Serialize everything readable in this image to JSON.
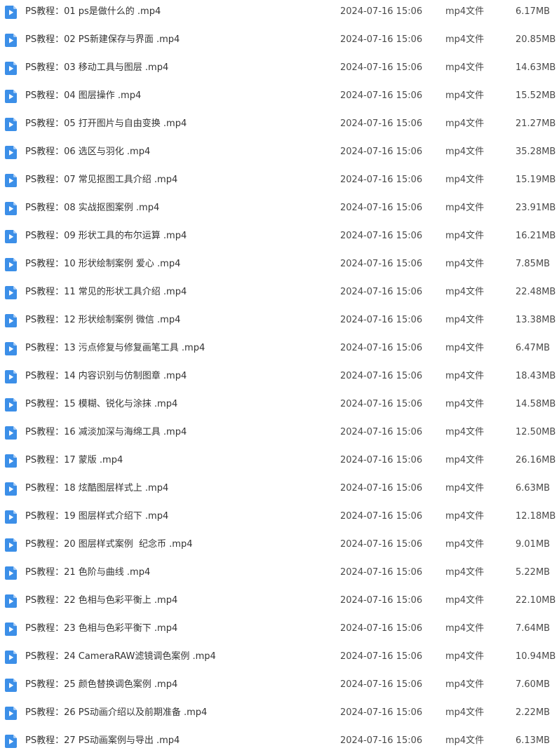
{
  "colors": {
    "icon_blue": "#3c8fe8",
    "icon_fold": "#a9cdf5",
    "text": "#333333"
  },
  "icon": "video-file-icon",
  "files": [
    {
      "name": "PS教程：01 ps是做什么的 .mp4",
      "date": "2024-07-16 15:06",
      "type": "mp4文件",
      "size": "6.17MB"
    },
    {
      "name": "PS教程：02 PS新建保存与界面 .mp4",
      "date": "2024-07-16 15:06",
      "type": "mp4文件",
      "size": "20.85MB"
    },
    {
      "name": "PS教程：03 移动工具与图层 .mp4",
      "date": "2024-07-16 15:06",
      "type": "mp4文件",
      "size": "14.63MB"
    },
    {
      "name": "PS教程：04 图层操作 .mp4",
      "date": "2024-07-16 15:06",
      "type": "mp4文件",
      "size": "15.52MB"
    },
    {
      "name": "PS教程：05 打开图片与自由变换 .mp4",
      "date": "2024-07-16 15:06",
      "type": "mp4文件",
      "size": "21.27MB"
    },
    {
      "name": "PS教程：06 选区与羽化 .mp4",
      "date": "2024-07-16 15:06",
      "type": "mp4文件",
      "size": "35.28MB"
    },
    {
      "name": "PS教程：07 常见抠图工具介绍 .mp4",
      "date": "2024-07-16 15:06",
      "type": "mp4文件",
      "size": "15.19MB"
    },
    {
      "name": "PS教程：08 实战抠图案例 .mp4",
      "date": "2024-07-16 15:06",
      "type": "mp4文件",
      "size": "23.91MB"
    },
    {
      "name": "PS教程：09 形状工具的布尔运算 .mp4",
      "date": "2024-07-16 15:06",
      "type": "mp4文件",
      "size": "16.21MB"
    },
    {
      "name": "PS教程：10 形状绘制案例 爱心 .mp4",
      "date": "2024-07-16 15:06",
      "type": "mp4文件",
      "size": "7.85MB"
    },
    {
      "name": "PS教程：11 常见的形状工具介绍 .mp4",
      "date": "2024-07-16 15:06",
      "type": "mp4文件",
      "size": "22.48MB"
    },
    {
      "name": "PS教程：12 形状绘制案例 微信 .mp4",
      "date": "2024-07-16 15:06",
      "type": "mp4文件",
      "size": "13.38MB"
    },
    {
      "name": "PS教程：13 污点修复与修复画笔工具 .mp4",
      "date": "2024-07-16 15:06",
      "type": "mp4文件",
      "size": "6.47MB"
    },
    {
      "name": "PS教程：14 内容识别与仿制图章 .mp4",
      "date": "2024-07-16 15:06",
      "type": "mp4文件",
      "size": "18.43MB"
    },
    {
      "name": "PS教程：15 模糊、锐化与涂抹 .mp4",
      "date": "2024-07-16 15:06",
      "type": "mp4文件",
      "size": "14.58MB"
    },
    {
      "name": "PS教程：16 减淡加深与海绵工具 .mp4",
      "date": "2024-07-16 15:06",
      "type": "mp4文件",
      "size": "12.50MB"
    },
    {
      "name": "PS教程：17 蒙版 .mp4",
      "date": "2024-07-16 15:06",
      "type": "mp4文件",
      "size": "26.16MB"
    },
    {
      "name": "PS教程：18 炫酷图层样式上 .mp4",
      "date": "2024-07-16 15:06",
      "type": "mp4文件",
      "size": "6.63MB"
    },
    {
      "name": "PS教程：19 图层样式介绍下 .mp4",
      "date": "2024-07-16 15:06",
      "type": "mp4文件",
      "size": "12.18MB"
    },
    {
      "name": "PS教程：20 图层样式案例  纪念币 .mp4",
      "date": "2024-07-16 15:06",
      "type": "mp4文件",
      "size": "9.01MB"
    },
    {
      "name": "PS教程：21 色阶与曲线 .mp4",
      "date": "2024-07-16 15:06",
      "type": "mp4文件",
      "size": "5.22MB"
    },
    {
      "name": "PS教程：22 色相与色彩平衡上 .mp4",
      "date": "2024-07-16 15:06",
      "type": "mp4文件",
      "size": "22.10MB"
    },
    {
      "name": "PS教程：23 色相与色彩平衡下 .mp4",
      "date": "2024-07-16 15:06",
      "type": "mp4文件",
      "size": "7.64MB"
    },
    {
      "name": "PS教程：24 CameraRAW滤镜调色案例 .mp4",
      "date": "2024-07-16 15:06",
      "type": "mp4文件",
      "size": "10.94MB"
    },
    {
      "name": "PS教程：25 颜色替换调色案例 .mp4",
      "date": "2024-07-16 15:06",
      "type": "mp4文件",
      "size": "7.60MB"
    },
    {
      "name": "PS教程：26 PS动画介绍以及前期准备 .mp4",
      "date": "2024-07-16 15:06",
      "type": "mp4文件",
      "size": "2.22MB"
    },
    {
      "name": "PS教程：27 PS动画案例与导出 .mp4",
      "date": "2024-07-16 15:06",
      "type": "mp4文件",
      "size": "6.13MB"
    }
  ]
}
